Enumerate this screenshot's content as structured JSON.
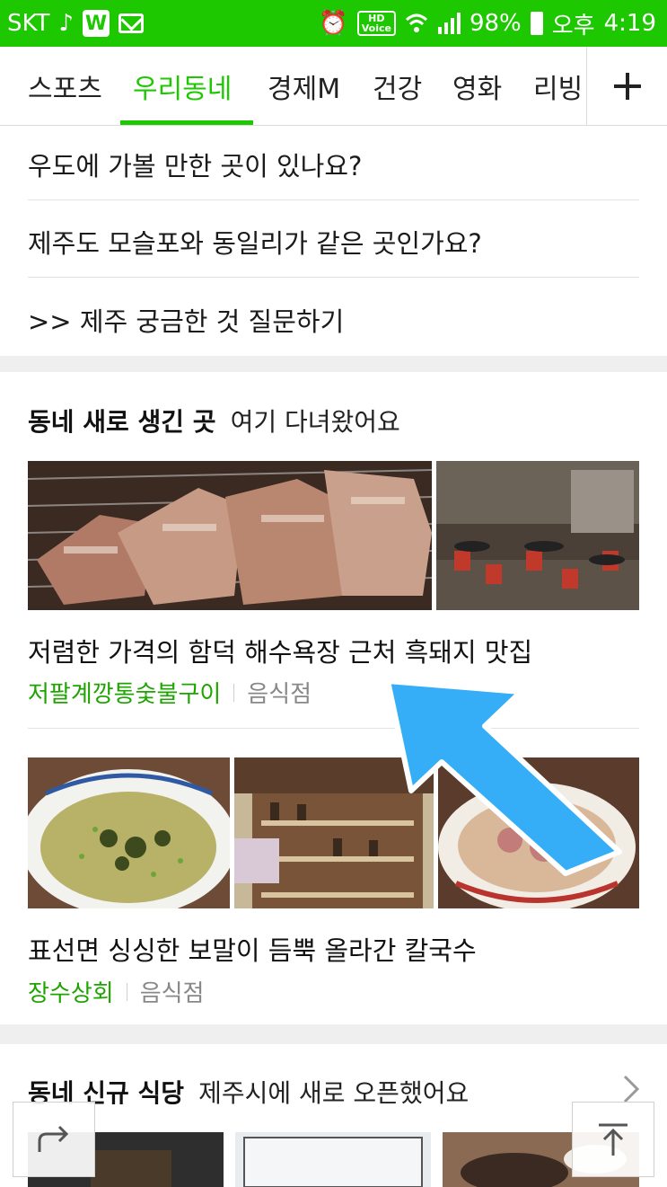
{
  "status_bar": {
    "carrier": "SKT",
    "battery": "98%",
    "ampm": "오후",
    "time": "4:19",
    "hd_label": "HD",
    "voice_label": "Voice",
    "w_label": "W"
  },
  "tabs": [
    "스포츠",
    "우리동네",
    "경제M",
    "건강",
    "영화",
    "리빙"
  ],
  "active_tab": "우리동네",
  "qa_items": [
    "우도에 가볼 만한 곳이 있나요?",
    "제주도 모슬포와 동일리가 같은 곳인가요?",
    ">> 제주 궁금한 것 질문하기"
  ],
  "section1": {
    "title": "동네 새로 생긴 곳",
    "subtitle": "여기 다녀왔어요",
    "cards": [
      {
        "title": "저렴한 가격의 함덕 해수욕장 근처 흑돼지 맛집",
        "shop": "저팔계깡통숯불구이",
        "category": "음식점"
      },
      {
        "title": "표선면 싱싱한 보말이 듬뿍 올라간 칼국수",
        "shop": "장수상회",
        "category": "음식점"
      }
    ]
  },
  "section2": {
    "title": "동네 신규 식당",
    "subtitle": "제주시에 새로 오픈했어요"
  },
  "colors": {
    "brand_green": "#1ec800",
    "shop_green": "#1ea400",
    "arrow_blue": "#35aef7"
  }
}
